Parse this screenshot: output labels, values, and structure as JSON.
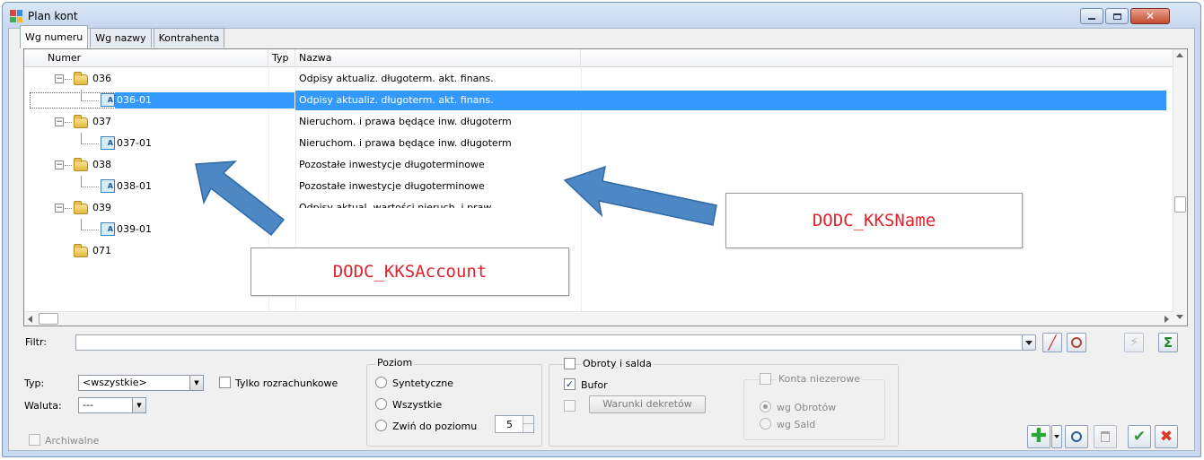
{
  "window": {
    "title": "Plan kont",
    "icons": [
      "app-icon",
      "minimize-icon",
      "maximize-icon",
      "close-icon"
    ]
  },
  "tabs": [
    {
      "label": "Wg numeru",
      "active": true
    },
    {
      "label": "Wg nazwy",
      "active": false
    },
    {
      "label": "Kontrahenta",
      "active": false
    }
  ],
  "grid": {
    "columns": {
      "number": "Numer",
      "type": "Typ",
      "name": "Nazwa"
    },
    "rows": [
      {
        "number": "036",
        "level": 0,
        "kind": "folder",
        "name": "Odpisy aktualiz. długoterm. akt. finans.",
        "selected": false
      },
      {
        "number": "036-01",
        "level": 1,
        "kind": "account",
        "name": "Odpisy aktualiz. długoterm. akt. finans.",
        "selected": true
      },
      {
        "number": "037",
        "level": 0,
        "kind": "folder",
        "name": "Nieruchom. i prawa będące inw. długoterm",
        "selected": false
      },
      {
        "number": "037-01",
        "level": 1,
        "kind": "account",
        "name": "Nieruchom. i prawa będące inw. długoterm",
        "selected": false
      },
      {
        "number": "038",
        "level": 0,
        "kind": "folder",
        "name": "Pozostałe inwestycje długoterminowe",
        "selected": false
      },
      {
        "number": "038-01",
        "level": 1,
        "kind": "account",
        "name": "Pozostałe inwestycje długoterminowe",
        "selected": false
      },
      {
        "number": "039",
        "level": 0,
        "kind": "folder",
        "name": "Odpisy aktual. wartości nieruch. i praw",
        "selected": false
      },
      {
        "number": "039-01",
        "level": 1,
        "kind": "account",
        "name": "",
        "selected": false
      },
      {
        "number": "071",
        "level": 0,
        "kind": "folder-leaf",
        "name": "",
        "selected": false
      }
    ]
  },
  "annotations": {
    "account": "DODC_KKSAccount",
    "name": "DODC_KKSName",
    "arrow_color": "#4d88c4"
  },
  "filter": {
    "label": "Filtr:",
    "value": ""
  },
  "type_field": {
    "label": "Typ:",
    "value": "<wszystkie>"
  },
  "currency_field": {
    "label": "Waluta:",
    "value": "---"
  },
  "only_settlement": {
    "label": "Tylko rozrachunkowe",
    "checked": false
  },
  "archived": {
    "label": "Archiwalne",
    "checked": false,
    "enabled": false
  },
  "level_group": {
    "title": "Poziom",
    "options": [
      "Syntetyczne",
      "Wszystkie",
      "Zwiń do poziomu"
    ],
    "collapse_level": "5"
  },
  "turnover": {
    "label": "Obroty i salda",
    "checked": false,
    "buffer": {
      "label": "Bufor",
      "checked": true
    },
    "conditions_button": "Warunki dekretów",
    "conditions_checked": false
  },
  "nonzero": {
    "label": "Konta niezerowe",
    "enabled": false,
    "options": [
      "wg Obrotów",
      "wg Sald"
    ]
  },
  "colors": {
    "selection": "#3399ff",
    "annotation_text": "#e0242d",
    "window_frame": "#c9daf0"
  }
}
